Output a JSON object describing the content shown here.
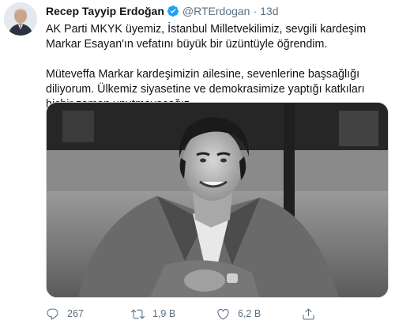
{
  "tweet": {
    "author_name": "Recep Tayyip Erdoğan",
    "handle": "@RTErdogan",
    "separator": "·",
    "time": "13d",
    "paragraphs": [
      "AK Parti MKYK üyemiz, İstanbul Milletvekilimiz, sevgili kardeşim Markar Esayan'ın vefatını büyük bir üzüntüyle öğrendim.",
      "Müteveffa Markar kardeşimizin ailesine, sevenlerine başsağlığı diliyorum. Ülkemiz siyasetine ve demokrasimize yaptığı katkıları hiçbir zaman unutmayacağız."
    ]
  },
  "actions": {
    "reply_count": "267",
    "retweet_count": "1,9 B",
    "like_count": "6,2 B"
  },
  "colors": {
    "verified": "#1da1f2",
    "muted": "#5b7083",
    "text": "#0f1419",
    "border": "#cfd9de"
  },
  "icons": [
    "verified-badge-icon",
    "reply-icon",
    "retweet-icon",
    "like-icon",
    "share-icon"
  ]
}
